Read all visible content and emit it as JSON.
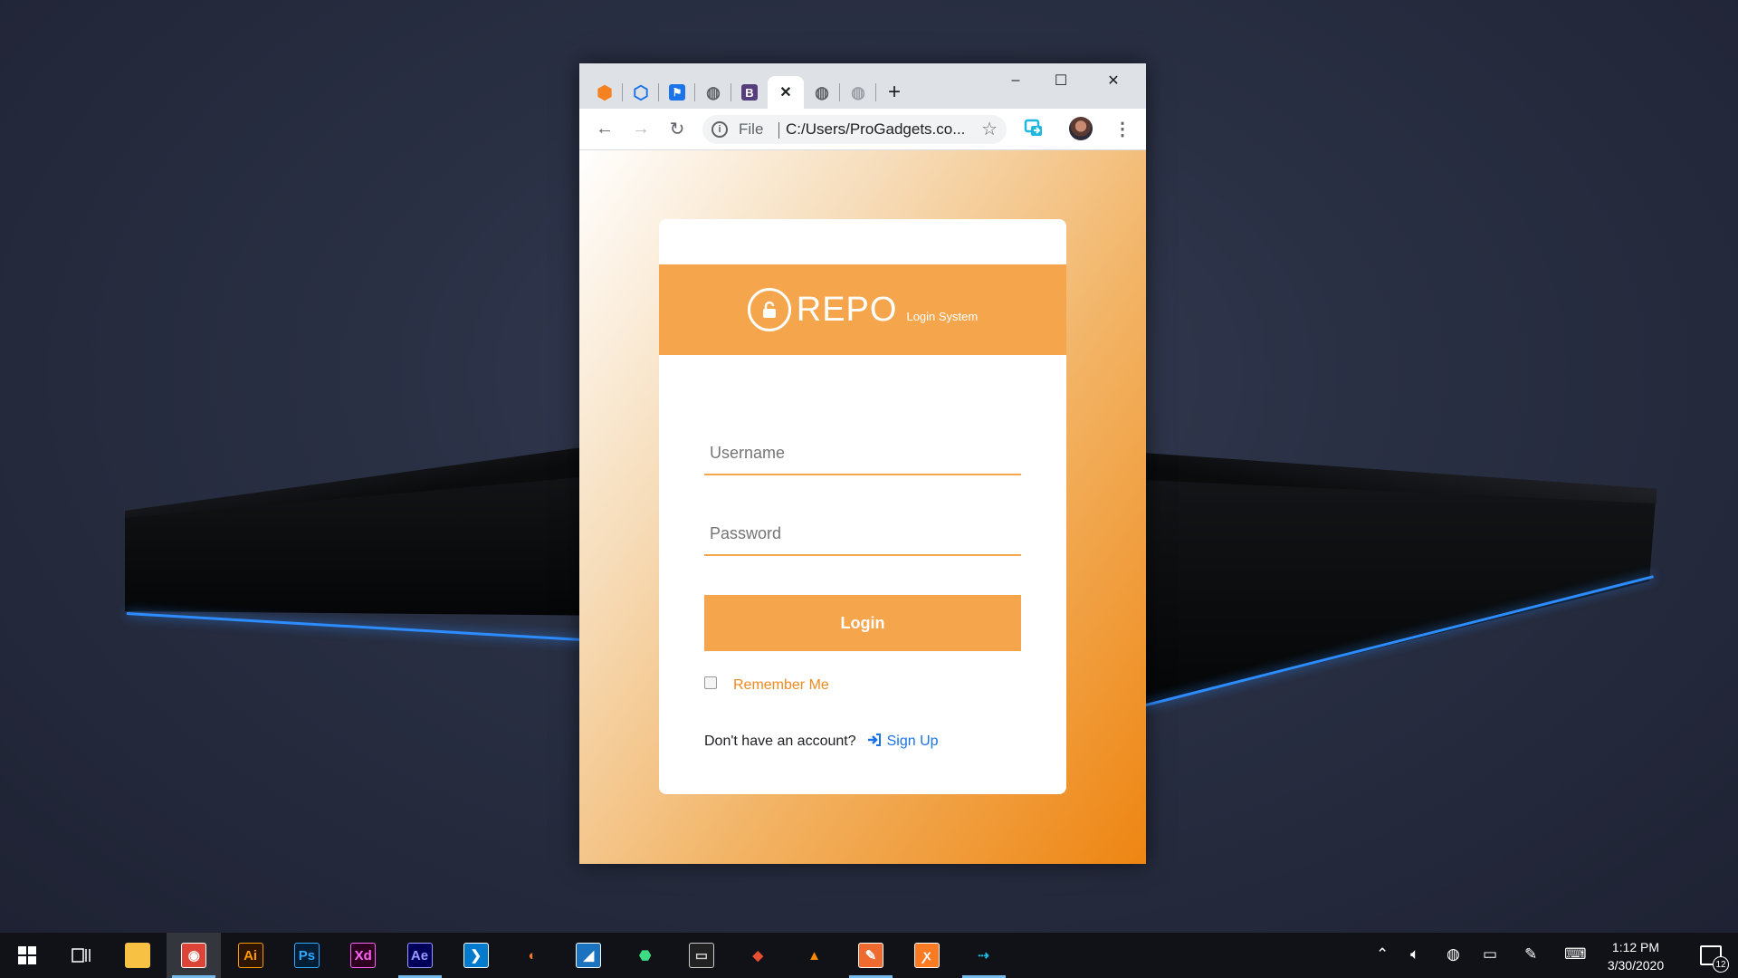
{
  "browser": {
    "tabs": [
      {
        "icon": "cube-icon",
        "color": "#f58220",
        "glyph": "⬢"
      },
      {
        "icon": "ring-icon",
        "color": "#1a73e8",
        "glyph": "⬡"
      },
      {
        "icon": "flag-icon",
        "color": "#1a73e8",
        "glyph": "⚑"
      },
      {
        "icon": "globe-icon",
        "color": "#5f6368",
        "glyph": "◍"
      },
      {
        "icon": "bootstrap-icon",
        "color": "#563d7c",
        "glyph": "B"
      },
      {
        "icon": "close-icon",
        "color": "#202124",
        "glyph": "✕",
        "active": true
      },
      {
        "icon": "globe-icon",
        "color": "#5f6368",
        "glyph": "◍"
      },
      {
        "icon": "globe-icon",
        "color": "#5f6368",
        "glyph": "◍"
      }
    ],
    "new_tab": "+",
    "window_controls": {
      "minimize": "–",
      "maximize": "☐",
      "close": "✕"
    },
    "toolbar": {
      "back": "←",
      "forward": "→",
      "reload": "↻",
      "info": "i",
      "scheme": "File",
      "url": "C:/Users/ProGadgets.co...",
      "star": "☆",
      "menu": "⋮"
    }
  },
  "login": {
    "brand": "REPO",
    "brand_sub": "Login System",
    "username_placeholder": "Username",
    "password_placeholder": "Password",
    "login_button": "Login",
    "remember_me": "Remember Me",
    "no_account": "Don't have an account?",
    "sign_up": "Sign Up"
  },
  "taskbar": {
    "apps": [
      {
        "name": "file-explorer-icon",
        "glyph": "▬",
        "bg": "#f7c244",
        "fg": "#f7c244"
      },
      {
        "name": "chrome-icon",
        "glyph": "◉",
        "bg": "#db4437",
        "fg": "#fff",
        "active": true
      },
      {
        "name": "illustrator-icon",
        "glyph": "Ai",
        "bg": "#2e1500",
        "fg": "#ff9a00"
      },
      {
        "name": "photoshop-icon",
        "glyph": "Ps",
        "bg": "#001e36",
        "fg": "#31a8ff"
      },
      {
        "name": "xd-icon",
        "glyph": "Xd",
        "bg": "#2e001f",
        "fg": "#ff61f6"
      },
      {
        "name": "after-effects-icon",
        "glyph": "Ae",
        "bg": "#00005b",
        "fg": "#9999ff"
      },
      {
        "name": "vscode-icon",
        "glyph": "❯",
        "bg": "#007acc",
        "fg": "#fff"
      },
      {
        "name": "blender-icon",
        "glyph": "◐",
        "bg": "#101217",
        "fg": "#f5792a"
      },
      {
        "name": "affinity-icon",
        "glyph": "◢",
        "bg": "#1b72be",
        "fg": "#fff"
      },
      {
        "name": "android-studio-icon",
        "glyph": "⬣",
        "bg": "#101217",
        "fg": "#3ddc84"
      },
      {
        "name": "terminal-icon",
        "glyph": "▭",
        "bg": "#222",
        "fg": "#ccc"
      },
      {
        "name": "git-icon",
        "glyph": "◆",
        "bg": "#101217",
        "fg": "#e94e31"
      },
      {
        "name": "vlc-icon",
        "glyph": "▲",
        "bg": "#101217",
        "fg": "#ff8800"
      },
      {
        "name": "brackets-icon",
        "glyph": "✎",
        "bg": "#ef6a2f",
        "fg": "#fff"
      },
      {
        "name": "xampp-icon",
        "glyph": "ꭗ",
        "bg": "#fb7a24",
        "fg": "#fff"
      },
      {
        "name": "screen-share-icon",
        "glyph": "⇢",
        "bg": "#101217",
        "fg": "#1fb7e0"
      }
    ],
    "time": "1:12 PM",
    "date": "3/30/2020",
    "notifications": "12"
  }
}
